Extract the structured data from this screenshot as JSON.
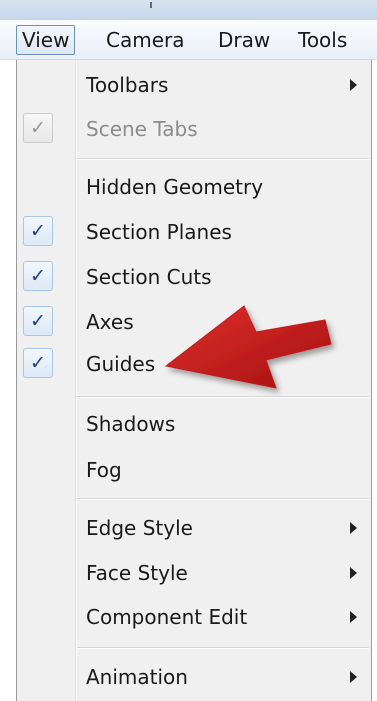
{
  "menubar": {
    "items": [
      {
        "label": "View",
        "active": true
      },
      {
        "label": "Camera"
      },
      {
        "label": "Draw"
      },
      {
        "label": "Tools"
      }
    ]
  },
  "menu": {
    "items": [
      {
        "label": "Toolbars",
        "submenu": true
      },
      {
        "label": "Scene Tabs",
        "checked": true,
        "disabled": true
      },
      {
        "label": "Hidden Geometry"
      },
      {
        "label": "Section Planes",
        "checked": true
      },
      {
        "label": "Section Cuts",
        "checked": true
      },
      {
        "label": "Axes",
        "checked": true
      },
      {
        "label": "Guides",
        "checked": true
      },
      {
        "label": "Shadows"
      },
      {
        "label": "Fog"
      },
      {
        "label": "Edge Style",
        "submenu": true
      },
      {
        "label": "Face Style",
        "submenu": true
      },
      {
        "label": "Component Edit",
        "submenu": true
      },
      {
        "label": "Animation",
        "submenu": true
      }
    ],
    "check_glyph": "✓"
  },
  "annotation": {
    "arrow_color": "#c41a1a",
    "points_to": "Guides"
  },
  "colors": {
    "menubar_bg": "#eaf0f7",
    "menu_bg": "#f0f0f0",
    "check_color": "#1e3f8a"
  }
}
